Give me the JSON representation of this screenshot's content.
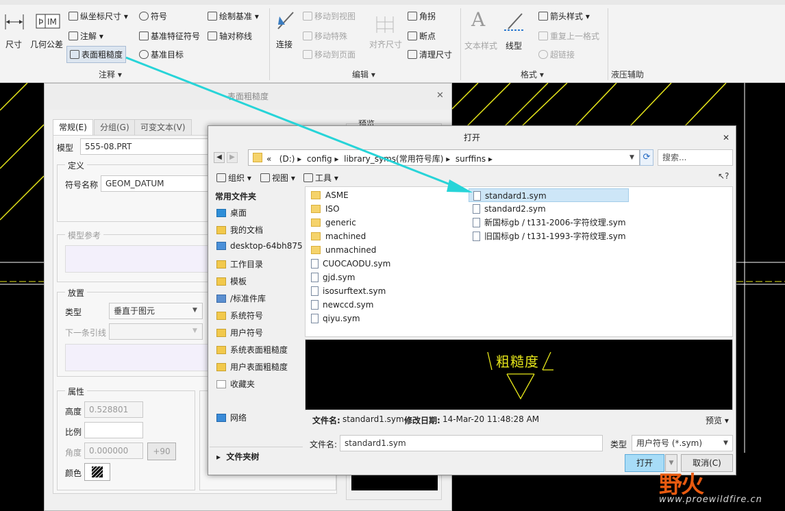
{
  "ribbon": {
    "dim_label": "尺寸",
    "gtol_label": "几何公差",
    "ordinate_label": "纵坐标尺寸",
    "note_label": "注解",
    "surface_finish_label": "表面粗糙度",
    "symbol_label": "符号",
    "datum_feature_label": "基准特征符号",
    "datum_target_label": "基准目标",
    "draw_datum_label": "绘制基准",
    "axis_sym_label": "轴对称线",
    "group_annotation": "注释",
    "move_to_view": "移动到视图",
    "move_special": "移动特殊",
    "move_to_page": "移动到页面",
    "connect_label": "连接",
    "align_dim_label": "对齐尺寸",
    "corner_label": "角拐",
    "breakpoint_label": "断点",
    "cleanup_dim_label": "清理尺寸",
    "group_edit": "编辑",
    "text_style_label": "文本样式",
    "line_style_label": "线型",
    "arrow_style_label": "箭头样式",
    "repeat_format_label": "重复上一格式",
    "hyperlink_label": "超链接",
    "group_format": "格式",
    "group_hydraulic": "液压辅助"
  },
  "dialog1": {
    "title": "表面粗糙度",
    "tabs": [
      "常规(E)",
      "分组(G)",
      "可变文本(V)"
    ],
    "model_label": "模型",
    "model_value": "555-08.PRT",
    "definition_label": "定义",
    "symbol_name_label": "符号名称",
    "symbol_name_value": "GEOM_DATUM",
    "model_ref_label": "模型参考",
    "placement_label": "放置",
    "type_label": "类型",
    "type_value": "垂直于图元",
    "next_leader_label": "下一条引线",
    "attributes_label": "属性",
    "height_label": "高度",
    "height_value": "0.528801",
    "scale_label": "比例",
    "angle_label": "角度",
    "angle_value": "0.000000",
    "rotate_button": "+90",
    "color_label": "颜色",
    "preview_label": "预览"
  },
  "dialog2": {
    "title": "打开",
    "path": [
      "«",
      "(D:)",
      "config",
      "library_syms(常用符号库)",
      "surffins"
    ],
    "search_placeholder": "搜索...",
    "toolbar": {
      "organize": "组织",
      "view": "视图",
      "tools": "工具"
    },
    "nav_header": "常用文件夹",
    "nav_items": [
      "桌面",
      "我的文档",
      "desktop-64bh875",
      "工作目录",
      "模板",
      "/标准件库",
      "系统符号",
      "用户符号",
      "系统表面粗糙度",
      "用户表面粗糙度",
      "收藏夹",
      "网络"
    ],
    "folder_tree": "文件夹树",
    "files_col1": [
      {
        "name": "ASME",
        "kind": "folder"
      },
      {
        "name": "ISO",
        "kind": "folder"
      },
      {
        "name": "generic",
        "kind": "folder"
      },
      {
        "name": "machined",
        "kind": "folder"
      },
      {
        "name": "unmachined",
        "kind": "folder"
      },
      {
        "name": "CUOCAODU.sym",
        "kind": "file"
      },
      {
        "name": "gjd.sym",
        "kind": "file"
      },
      {
        "name": "isosurftext.sym",
        "kind": "file"
      },
      {
        "name": "newccd.sym",
        "kind": "file"
      },
      {
        "name": "qiyu.sym",
        "kind": "file"
      }
    ],
    "files_col2": [
      {
        "name": "standard1.sym",
        "kind": "file",
        "selected": true
      },
      {
        "name": "standard2.sym",
        "kind": "file"
      },
      {
        "name": "新国标gb / t131-2006-字符纹理.sym",
        "kind": "file"
      },
      {
        "name": "旧国标gb / t131-1993-字符纹理.sym",
        "kind": "file"
      }
    ],
    "preview_text": "粗糙度",
    "info_name_label": "文件名:",
    "info_name_value": "standard1.sym",
    "info_date_label": "修改日期:",
    "info_date_value": "14-Mar-20 11:48:28 AM",
    "preview_toggle": "预览",
    "filename_label": "文件名:",
    "filename_value": "standard1.sym",
    "type_label": "类型",
    "type_value": "用户符号 (*.sym)",
    "open_button": "打开",
    "cancel_button": "取消(C)"
  },
  "watermark": {
    "brand": "野火",
    "url": "www.proewildfire.cn"
  },
  "colors": {
    "drawing_line": "#e6e61a",
    "callout_arrow": "#27d4d8",
    "selection": "#cde6f7",
    "open_button": "#a7dcf7"
  }
}
